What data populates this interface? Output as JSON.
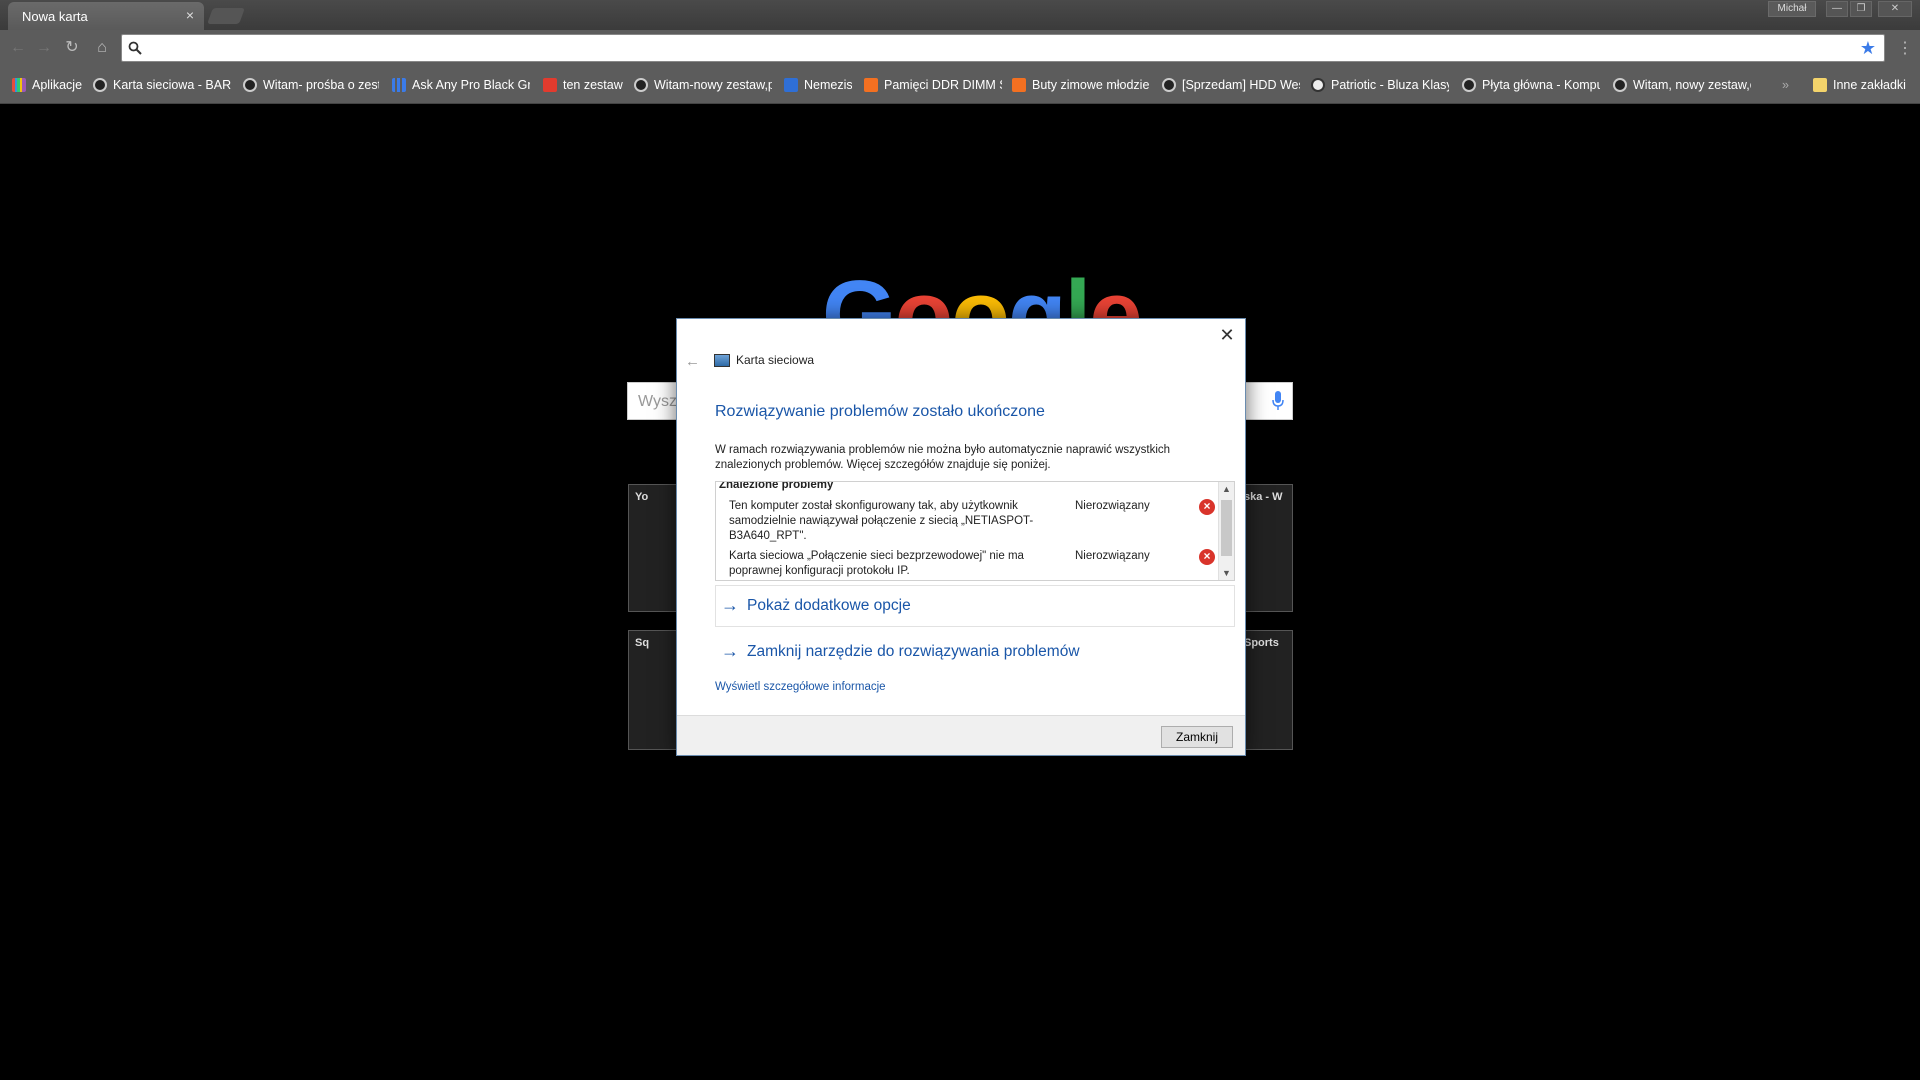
{
  "browser": {
    "tab_title": "Nowa karta",
    "tab_close": "×",
    "profile_name": "Michał",
    "window_controls": {
      "minimize": "—",
      "restore": "❐",
      "close": "✕"
    }
  },
  "toolbar": {
    "omnibox_value": "",
    "star_icon": "★"
  },
  "bookmarks": [
    {
      "label": "Aplikacje",
      "icon": "apps-grid-icon"
    },
    {
      "label": "Karta sieciowa - BARD",
      "icon": "e-icon"
    },
    {
      "label": "Witam- prośba o zest",
      "icon": "e-icon"
    },
    {
      "label": "Ask Any Pro Black Gr",
      "icon": "bars-icon"
    },
    {
      "label": "ten zestaw",
      "icon": "red-icon"
    },
    {
      "label": "Witam-nowy zestaw,p",
      "icon": "e-icon"
    },
    {
      "label": "Nemezis",
      "icon": "blue-icon"
    },
    {
      "label": "Pamięci DDR DIMM S",
      "icon": "allegro-icon"
    },
    {
      "label": "Buty zimowe młodzie",
      "icon": "allegro-icon"
    },
    {
      "label": "[Sprzedam] HDD Wes",
      "icon": "e-icon"
    },
    {
      "label": "Patriotic - Bluza Klasy",
      "icon": "patriotic-icon"
    },
    {
      "label": "Płyta główna - Kompu",
      "icon": "e-icon"
    },
    {
      "label": "Witam, nowy zestaw,c",
      "icon": "e-icon"
    },
    {
      "label": "»",
      "icon": ""
    },
    {
      "label": "Inne zakładki",
      "icon": "folder-icon"
    }
  ],
  "newtab": {
    "search_placeholder": "Wysz",
    "tiles": [
      {
        "title": "Yo"
      },
      {
        "title": "ska - W"
      },
      {
        "title": "Sq"
      },
      {
        "title": "Sports"
      }
    ]
  },
  "dialog": {
    "header_title": "Karta sieciowa",
    "heading": "Rozwiązywanie problemów zostało ukończone",
    "description": "W ramach rozwiązywania problemów nie można było automatycznie naprawić wszystkich znalezionych problemów. Więcej szczegółów znajduje się poniżej.",
    "problems_title": "Znalezione problemy",
    "problems": [
      {
        "text": "Ten komputer został skonfigurowany tak, aby użytkownik samodzielnie nawiązywał połączenie z siecią „NETIASPOT-B3A640_RPT\".",
        "status": "Nierozwiązany"
      },
      {
        "text": "Karta sieciowa „Połączenie sieci bezprzewodowej\" nie ma poprawnej konfiguracji protokołu IP.",
        "status": "Nierozwiązany"
      }
    ],
    "option_more": "Pokaż dodatkowe opcje",
    "option_close_tool": "Zamknij narzędzie do rozwiązywania problemów",
    "details_link": "Wyświetl szczegółowe informacje",
    "close_button": "Zamknij"
  }
}
